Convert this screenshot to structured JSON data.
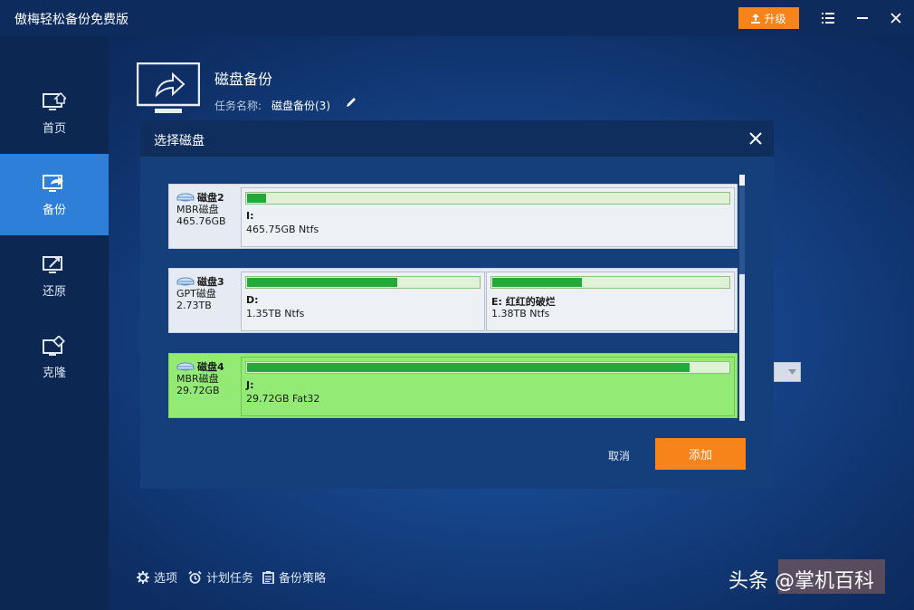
{
  "app": {
    "title": "傲梅轻松备份免费版",
    "upgrade_label": "升级"
  },
  "sidebar": {
    "items": [
      {
        "label": "首页",
        "icon": "home-monitor-icon"
      },
      {
        "label": "备份",
        "icon": "backup-monitor-icon",
        "active": true
      },
      {
        "label": "还原",
        "icon": "restore-monitor-icon"
      },
      {
        "label": "克隆",
        "icon": "clone-icon"
      }
    ]
  },
  "header": {
    "title": "磁盘备份",
    "task_name_label": "任务名称:",
    "task_name_value": "磁盘备份(3)"
  },
  "dialog": {
    "title": "选择磁盘",
    "cancel_label": "取消",
    "add_label": "添加",
    "disks": [
      {
        "name": "磁盘2",
        "type": "MBR磁盘",
        "size": "465.76GB",
        "selected": false,
        "partitions": [
          {
            "name": "I:",
            "detail": "465.75GB Ntfs",
            "used_fraction": 0.04
          }
        ]
      },
      {
        "name": "磁盘3",
        "type": "GPT磁盘",
        "size": "2.73TB",
        "selected": false,
        "partitions": [
          {
            "name": "D:",
            "detail": "1.35TB Ntfs",
            "used_fraction": 0.65
          },
          {
            "name": "E: 红红的破烂",
            "detail": "1.38TB Ntfs",
            "used_fraction": 0.38
          }
        ]
      },
      {
        "name": "磁盘4",
        "type": "MBR磁盘",
        "size": "29.72GB",
        "selected": true,
        "partitions": [
          {
            "name": "J:",
            "detail": "29.72GB Fat32",
            "used_fraction": 0.92
          }
        ]
      }
    ]
  },
  "bottom_bar": {
    "options_label": "选项",
    "schedule_label": "计划任务",
    "strategy_label": "备份策略"
  },
  "watermark": "头条 @掌机百科",
  "colors": {
    "accent_orange": "#f7831b",
    "active_blue": "#2d7fd8",
    "selected_green": "#93ea75",
    "usage_green": "#23a93a"
  }
}
